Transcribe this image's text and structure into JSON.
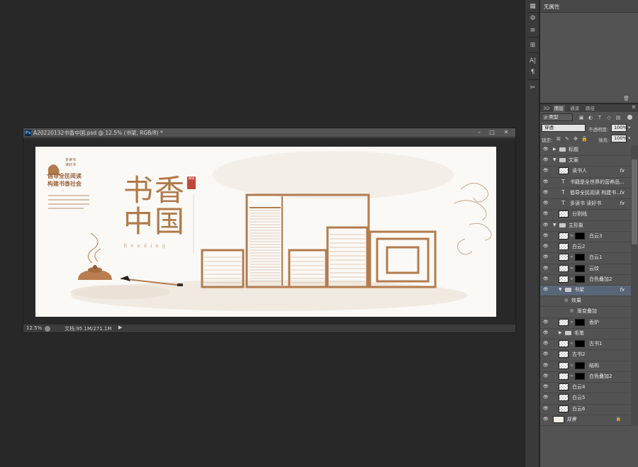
{
  "document": {
    "title": "A20220132书香中国.psd @ 12.5% (书架, RGB/8) *",
    "zoom": "12.5%",
    "doc_size": "文档:95.1M/271.1M"
  },
  "banner": {
    "title_line1": "书香",
    "title_line2": "中国",
    "subtitle": "Reading",
    "seal": "阅读",
    "slogan_line1": "倡导全民阅读",
    "slogan_line2": "构建书香社会",
    "badge_line1": "多读书",
    "badge_line2": "读好书",
    "brand_color": "#b07a4a"
  },
  "properties": {
    "header": "无属性"
  },
  "layers_panel": {
    "tabs": [
      "3D",
      "图层",
      "通道",
      "路径"
    ],
    "active_tab": "图层",
    "filter_kind": "类型",
    "blend_mode": "穿透",
    "opacity_label": "不透明度:",
    "opacity_value": "100%",
    "lock_label": "锁定:",
    "fill_label": "填充:",
    "fill_value": "100%",
    "layers": [
      {
        "name": "标题",
        "kind": "group",
        "indent": 0,
        "expanded": false
      },
      {
        "name": "文案",
        "kind": "group",
        "indent": 0,
        "expanded": true
      },
      {
        "name": "读书人",
        "kind": "image",
        "indent": 1,
        "fx": true
      },
      {
        "name": "书籍是全世界的营养品...",
        "kind": "text",
        "indent": 1
      },
      {
        "name": "倡导全民阅读 构建书...",
        "kind": "text",
        "indent": 1,
        "fx": true
      },
      {
        "name": "多读书 读好书",
        "kind": "text",
        "indent": 1,
        "fx": true
      },
      {
        "name": "分割线",
        "kind": "image",
        "indent": 1
      },
      {
        "name": "主形象",
        "kind": "group",
        "indent": 0,
        "expanded": true
      },
      {
        "name": "白云3",
        "kind": "masked",
        "indent": 1
      },
      {
        "name": "白云2",
        "kind": "image",
        "indent": 1
      },
      {
        "name": "白云1",
        "kind": "masked",
        "indent": 1
      },
      {
        "name": "云纹",
        "kind": "masked",
        "indent": 1
      },
      {
        "name": "白色叠加2",
        "kind": "masked",
        "indent": 1
      },
      {
        "name": "书架",
        "kind": "group",
        "indent": 1,
        "expanded": true,
        "fx": true,
        "selected": true
      },
      {
        "name": "效果",
        "kind": "effect",
        "indent": 2
      },
      {
        "name": "渐变叠加",
        "kind": "effect",
        "indent": 3
      },
      {
        "name": "香炉",
        "kind": "masked",
        "indent": 1
      },
      {
        "name": "毛笔",
        "kind": "group",
        "indent": 1,
        "expanded": false
      },
      {
        "name": "古书1",
        "kind": "masked",
        "indent": 1
      },
      {
        "name": "古书2",
        "kind": "image",
        "indent": 1
      },
      {
        "name": "结构",
        "kind": "masked",
        "indent": 1
      },
      {
        "name": "白色叠加2",
        "kind": "masked",
        "indent": 1
      },
      {
        "name": "白云4",
        "kind": "image",
        "indent": 1
      },
      {
        "name": "白云5",
        "kind": "image",
        "indent": 1
      },
      {
        "name": "白云6",
        "kind": "image",
        "indent": 1
      },
      {
        "name": "背景",
        "kind": "background",
        "indent": 0
      }
    ]
  }
}
